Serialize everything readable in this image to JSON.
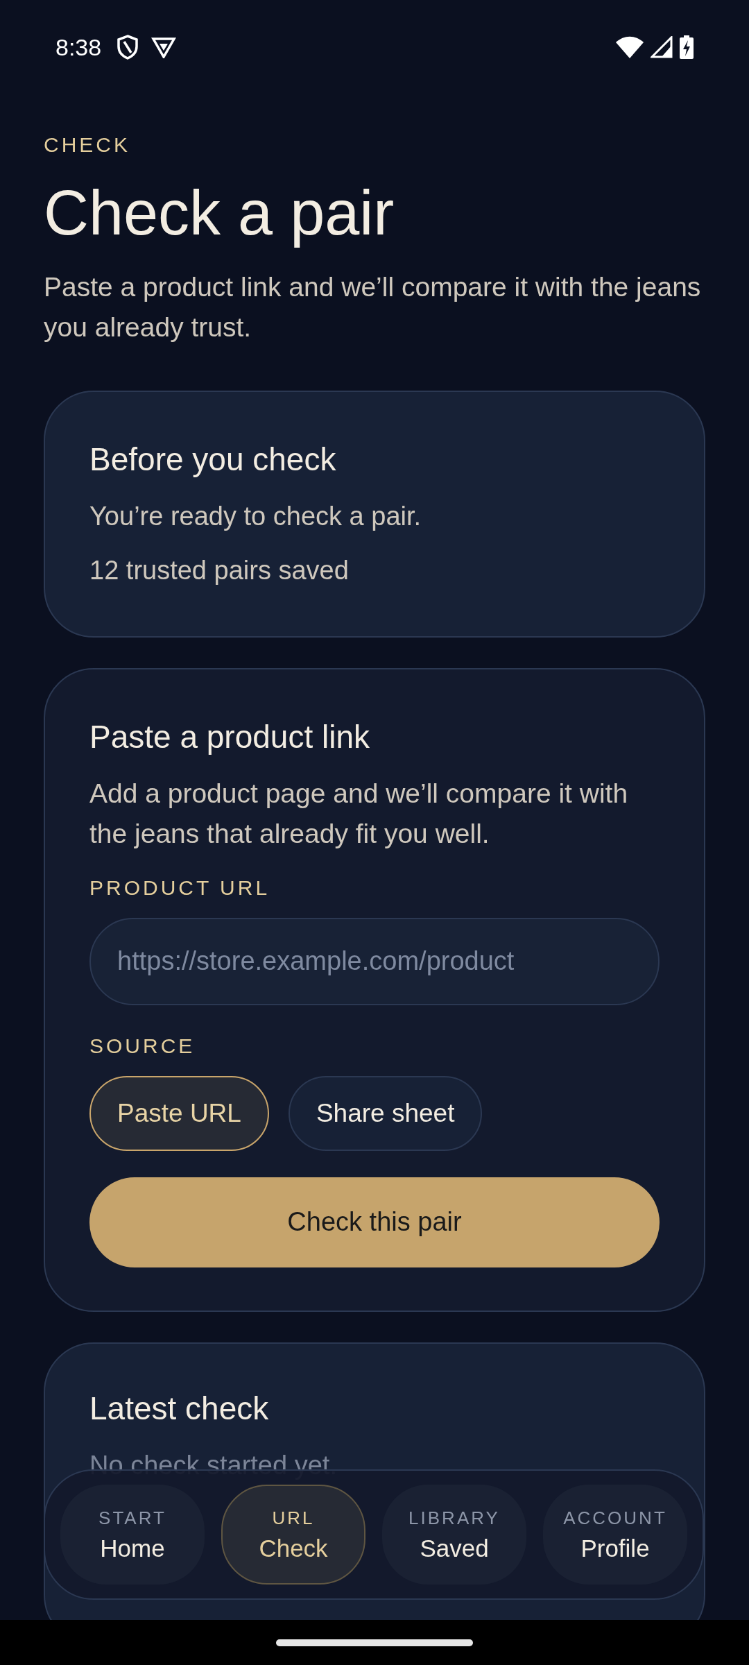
{
  "status_bar": {
    "time": "8:38"
  },
  "header": {
    "eyebrow": "CHECK",
    "title": "Check a pair",
    "subtitle": "Paste a product link and we’ll compare it with the jeans you already trust."
  },
  "readiness_card": {
    "title": "Before you check",
    "lines": [
      "You’re ready to check a pair.",
      "12 trusted pairs saved"
    ]
  },
  "link_card": {
    "title": "Paste a product link",
    "description": "Add a product page and we’ll compare it with the jeans that already fit you well.",
    "url_label": "PRODUCT URL",
    "url_field": {
      "placeholder": "https://store.example.com/product"
    },
    "source_label": "SOURCE",
    "sources": [
      {
        "label": "Paste URL",
        "selected": true
      },
      {
        "label": "Share sheet",
        "selected": false
      }
    ],
    "submit": "Check this pair"
  },
  "latest_card": {
    "title": "Latest check",
    "message": "No check started yet."
  },
  "bottom_nav": [
    {
      "eyebrow": "START",
      "label": "Home",
      "selected": false
    },
    {
      "eyebrow": "URL",
      "label": "Check",
      "selected": true
    },
    {
      "eyebrow": "LIBRARY",
      "label": "Saved",
      "selected": false
    },
    {
      "eyebrow": "ACCOUNT",
      "label": "Profile",
      "selected": false
    }
  ]
}
